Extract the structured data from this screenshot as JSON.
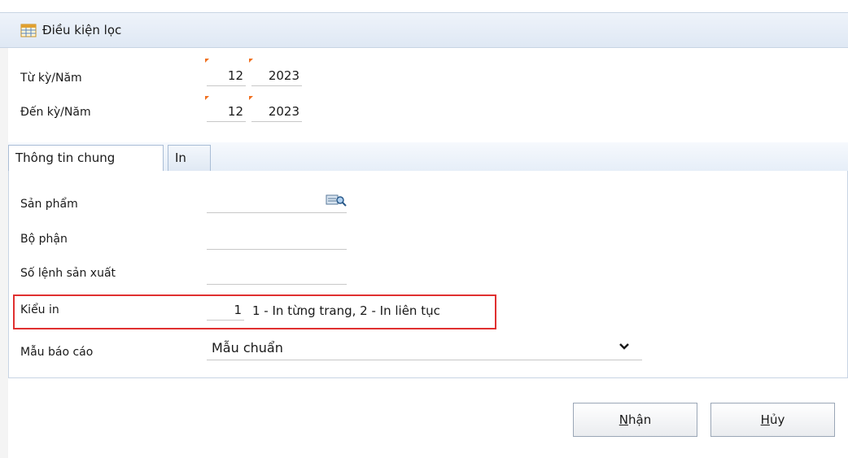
{
  "window": {
    "title": "Điều kiện lọc",
    "icon": "calendar-grid-icon"
  },
  "period": {
    "from_label": "Từ kỳ/Năm",
    "from_period": "12",
    "from_year": "2023",
    "to_label": "Đến kỳ/Năm",
    "to_period": "12",
    "to_year": "2023"
  },
  "tabs": [
    {
      "label": "Thông tin chung",
      "active": true
    },
    {
      "label": "In",
      "active": false
    }
  ],
  "form": {
    "product_label": "Sản phẩm",
    "product_value": "",
    "product_lookup_icon": "lookup-search-icon",
    "department_label": "Bộ phận",
    "department_value": "",
    "order_label": "Số lệnh sản xuất",
    "order_value": "",
    "print_type_label": "Kiểu in",
    "print_type_value": "1",
    "print_type_hint": "1 - In từng trang, 2 - In liên tục",
    "template_label": "Mẫu báo cáo",
    "template_value": "Mẫu chuẩn"
  },
  "buttons": {
    "ok_access_key": "N",
    "ok_rest": "hận",
    "cancel_access_key": "H",
    "cancel_rest": "ủy"
  },
  "colors": {
    "required_marker": "#f07020",
    "highlight_border": "#e03030"
  }
}
